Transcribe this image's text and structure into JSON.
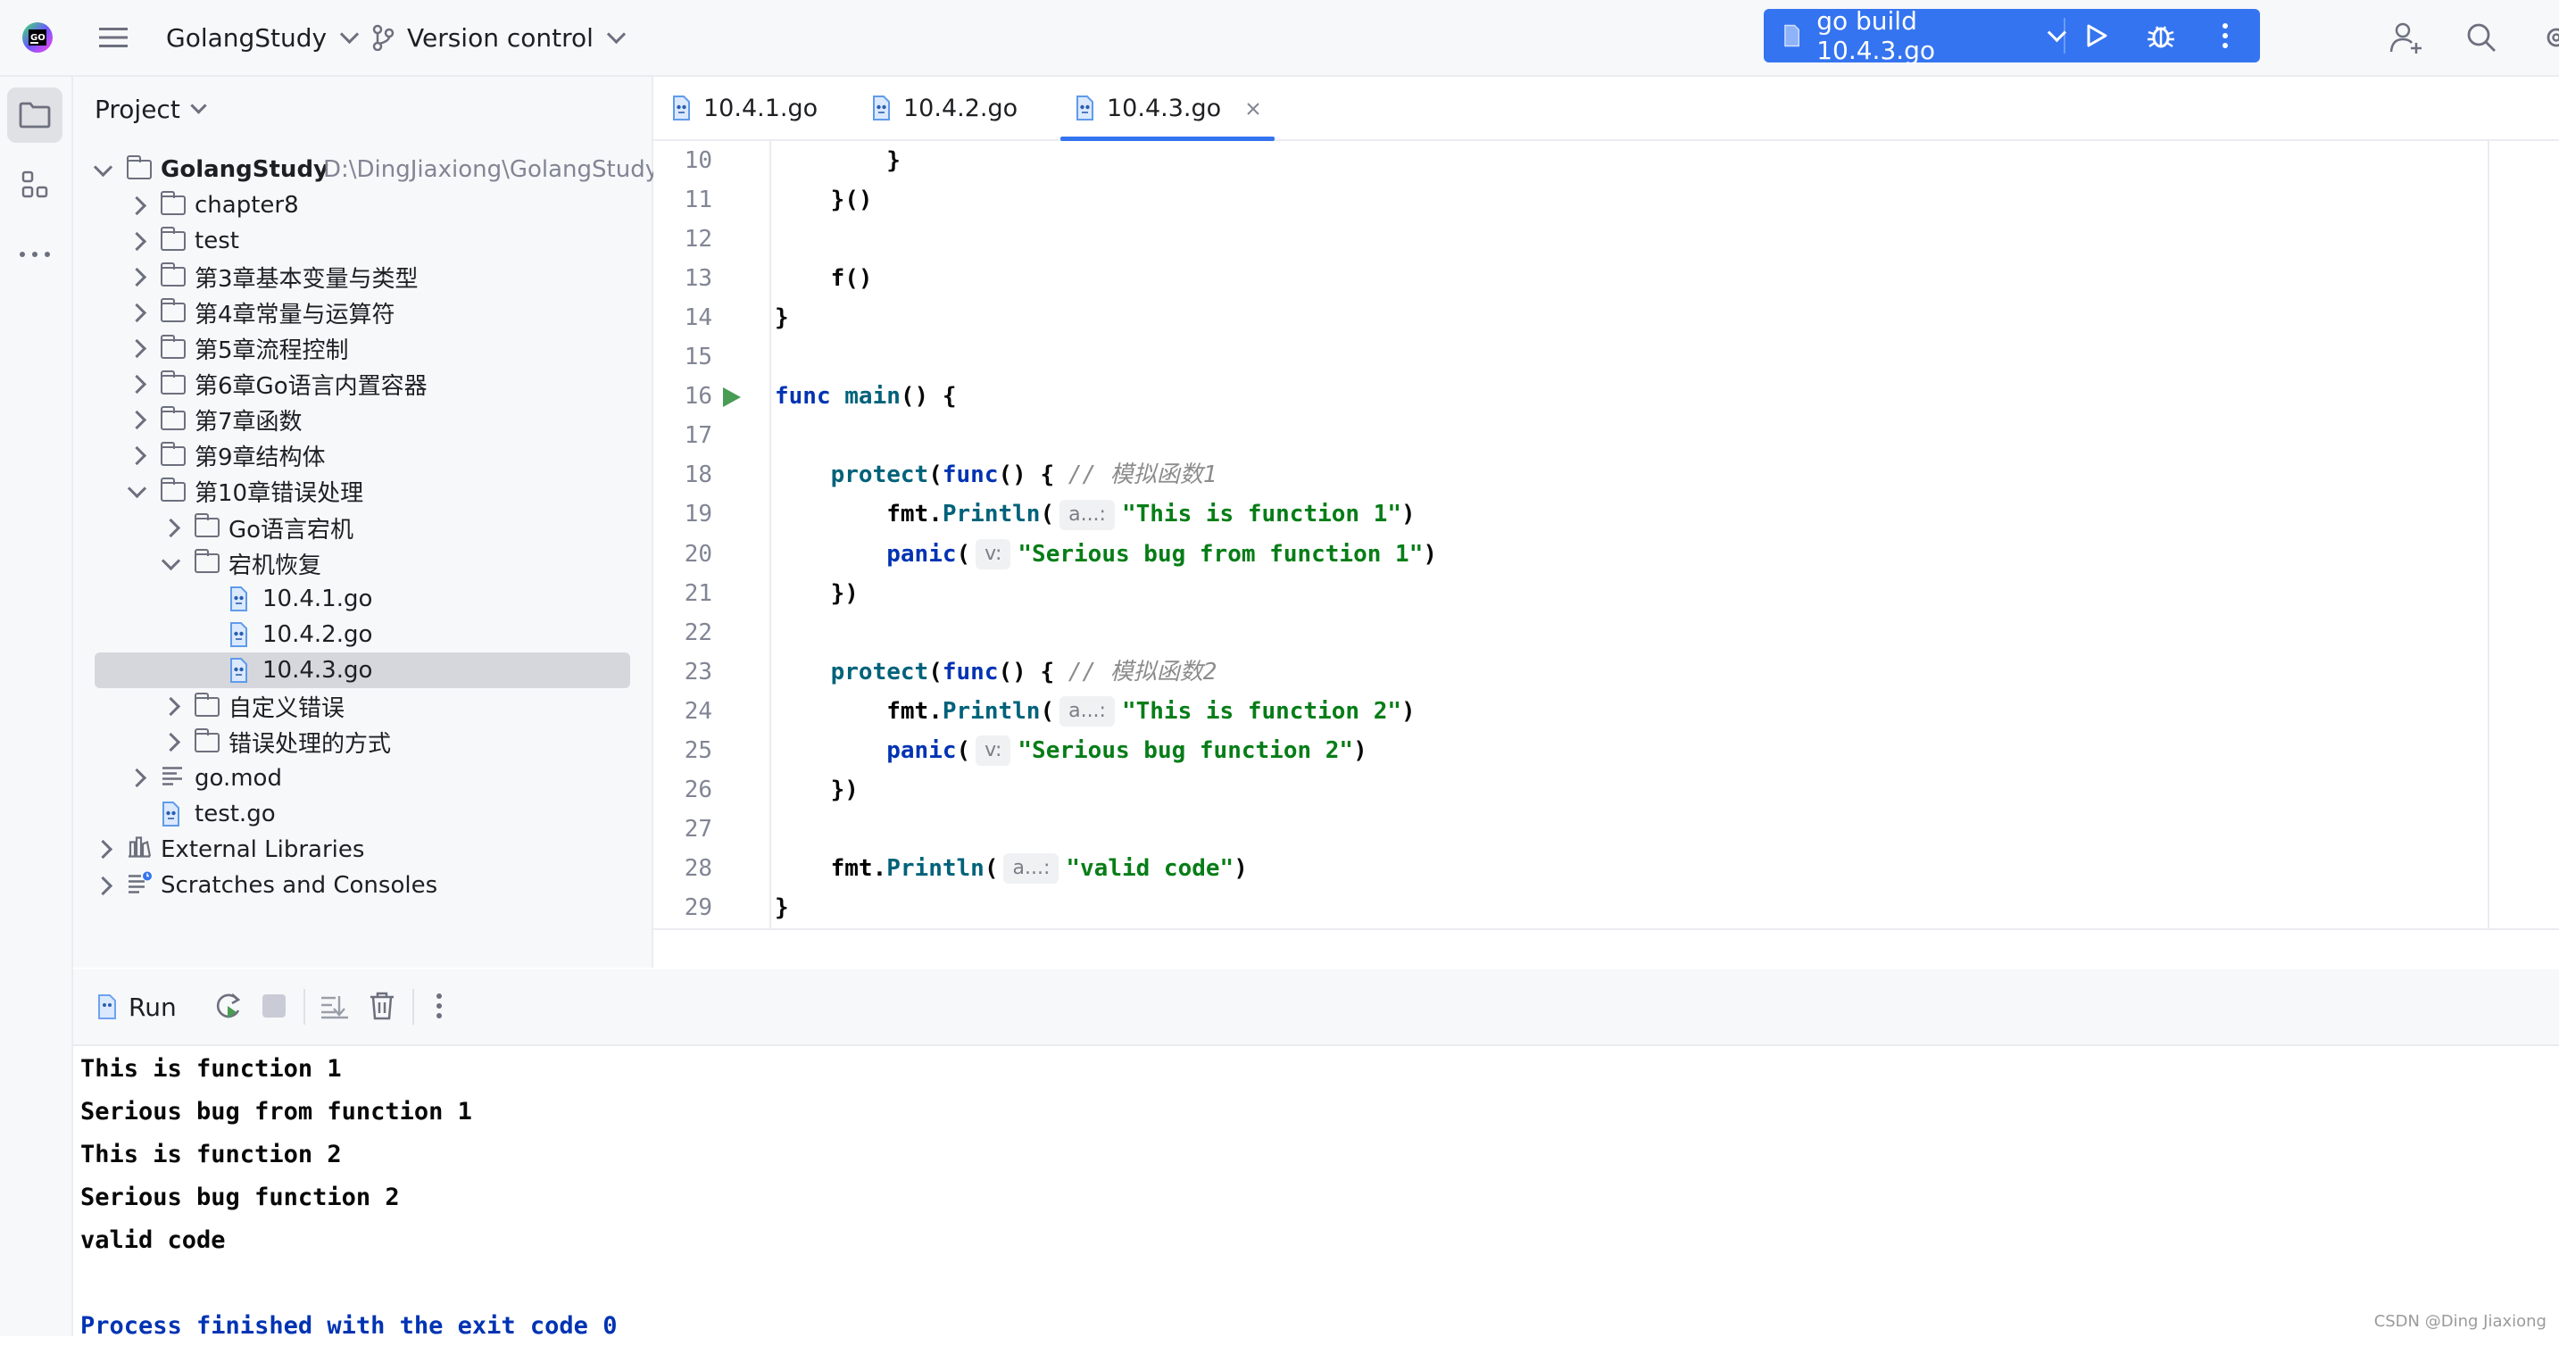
{
  "titlebar": {
    "project": "GolangStudy",
    "vcs": "Version control",
    "run_config": "go build 10.4.3.go"
  },
  "project_panel": {
    "title": "Project",
    "tree": [
      {
        "label": "GolangStudy",
        "hint": "D:\\DingJiaxiong\\GolangStudy",
        "level": 0,
        "type": "folder",
        "expanded": true
      },
      {
        "label": "chapter8",
        "level": 1,
        "type": "folder",
        "expanded": false
      },
      {
        "label": "test",
        "level": 1,
        "type": "folder",
        "expanded": false
      },
      {
        "label": "第3章基本变量与类型",
        "level": 1,
        "type": "folder",
        "expanded": false
      },
      {
        "label": "第4章常量与运算符",
        "level": 1,
        "type": "folder",
        "expanded": false
      },
      {
        "label": "第5章流程控制",
        "level": 1,
        "type": "folder",
        "expanded": false
      },
      {
        "label": "第6章Go语言内置容器",
        "level": 1,
        "type": "folder",
        "expanded": false
      },
      {
        "label": "第7章函数",
        "level": 1,
        "type": "folder",
        "expanded": false
      },
      {
        "label": "第9章结构体",
        "level": 1,
        "type": "folder",
        "expanded": false
      },
      {
        "label": "第10章错误处理",
        "level": 1,
        "type": "folder",
        "expanded": true
      },
      {
        "label": "Go语言宕机",
        "level": 2,
        "type": "folder",
        "expanded": false
      },
      {
        "label": "宕机恢复",
        "level": 2,
        "type": "folder",
        "expanded": true
      },
      {
        "label": "10.4.1.go",
        "level": 3,
        "type": "gofile"
      },
      {
        "label": "10.4.2.go",
        "level": 3,
        "type": "gofile"
      },
      {
        "label": "10.4.3.go",
        "level": 3,
        "type": "gofile",
        "selected": true
      },
      {
        "label": "自定义错误",
        "level": 2,
        "type": "folder",
        "expanded": false
      },
      {
        "label": "错误处理的方式",
        "level": 2,
        "type": "folder",
        "expanded": false
      },
      {
        "label": "go.mod",
        "level": 1,
        "type": "modfile",
        "expanded": false
      },
      {
        "label": "test.go",
        "level": 1,
        "type": "gofile"
      },
      {
        "label": "External Libraries",
        "level": 0,
        "type": "library",
        "expanded": false
      },
      {
        "label": "Scratches and Consoles",
        "level": 0,
        "type": "scratch",
        "expanded": false
      }
    ]
  },
  "tabs": [
    {
      "label": "10.4.1.go",
      "active": false
    },
    {
      "label": "10.4.2.go",
      "active": false
    },
    {
      "label": "10.4.3.go",
      "active": true
    }
  ],
  "editor": {
    "lines": [
      {
        "n": "10",
        "t": [
          [
            "",
            "        }"
          ]
        ]
      },
      {
        "n": "11",
        "t": [
          [
            "",
            "    }()"
          ]
        ]
      },
      {
        "n": "12",
        "t": []
      },
      {
        "n": "13",
        "t": [
          [
            "",
            "    f()"
          ]
        ]
      },
      {
        "n": "14",
        "t": [
          [
            "",
            "}"
          ]
        ]
      },
      {
        "n": "15",
        "t": []
      },
      {
        "n": "16",
        "run": true,
        "t": [
          [
            "kw",
            "func "
          ],
          [
            "fn",
            "main"
          ],
          [
            "",
            "() {"
          ]
        ]
      },
      {
        "n": "17",
        "t": []
      },
      {
        "n": "18",
        "t": [
          [
            "",
            "    "
          ],
          [
            "fn",
            "protect"
          ],
          [
            "",
            "("
          ],
          [
            "kw",
            "func"
          ],
          [
            "",
            "() { "
          ],
          [
            "cm",
            "// 模拟函数1"
          ]
        ]
      },
      {
        "n": "19",
        "t": [
          [
            "",
            "        "
          ],
          [
            "pkg",
            "fmt"
          ],
          [
            "",
            "."
          ],
          [
            "fn",
            "Println"
          ],
          [
            "",
            "("
          ],
          [
            "hint",
            "a...:"
          ],
          [
            "str",
            "\"This is function 1\""
          ],
          [
            "",
            ")"
          ]
        ]
      },
      {
        "n": "20",
        "t": [
          [
            "",
            "        "
          ],
          [
            "kw",
            "panic"
          ],
          [
            "",
            "("
          ],
          [
            "hint",
            "v:"
          ],
          [
            "str",
            "\"Serious bug from function 1\""
          ],
          [
            "",
            ")"
          ]
        ]
      },
      {
        "n": "21",
        "t": [
          [
            "",
            "    })"
          ]
        ]
      },
      {
        "n": "22",
        "t": []
      },
      {
        "n": "23",
        "t": [
          [
            "",
            "    "
          ],
          [
            "fn",
            "protect"
          ],
          [
            "",
            "("
          ],
          [
            "kw",
            "func"
          ],
          [
            "",
            "() { "
          ],
          [
            "cm",
            "// 模拟函数2"
          ]
        ]
      },
      {
        "n": "24",
        "t": [
          [
            "",
            "        "
          ],
          [
            "pkg",
            "fmt"
          ],
          [
            "",
            "."
          ],
          [
            "fn",
            "Println"
          ],
          [
            "",
            "("
          ],
          [
            "hint",
            "a...:"
          ],
          [
            "str",
            "\"This is function 2\""
          ],
          [
            "",
            ")"
          ]
        ]
      },
      {
        "n": "25",
        "t": [
          [
            "",
            "        "
          ],
          [
            "kw",
            "panic"
          ],
          [
            "",
            "("
          ],
          [
            "hint",
            "v:"
          ],
          [
            "str",
            "\"Serious bug function 2\""
          ],
          [
            "",
            ")"
          ]
        ]
      },
      {
        "n": "26",
        "t": [
          [
            "",
            "    })"
          ]
        ]
      },
      {
        "n": "27",
        "t": []
      },
      {
        "n": "28",
        "t": [
          [
            "",
            "    "
          ],
          [
            "pkg",
            "fmt"
          ],
          [
            "",
            "."
          ],
          [
            "fn",
            "Println"
          ],
          [
            "",
            "("
          ],
          [
            "hint",
            "a...:"
          ],
          [
            "str",
            "\"valid code\""
          ],
          [
            "",
            ")"
          ]
        ]
      },
      {
        "n": "29",
        "t": [
          [
            "",
            "}"
          ]
        ]
      }
    ]
  },
  "run_panel": {
    "title": "Run",
    "output": [
      "This is function 1",
      "Serious bug from function 1",
      "This is function 2",
      "Serious bug function 2",
      "valid code",
      "",
      "Process finished with the exit code 0"
    ]
  },
  "watermark": "CSDN @Ding Jiaxiong",
  "colors": {
    "accent": "#3574f0",
    "keyword": "#0033b3",
    "function": "#00627a",
    "string": "#067d17",
    "comment": "#8c8c8c",
    "run_green": "#499c54"
  }
}
